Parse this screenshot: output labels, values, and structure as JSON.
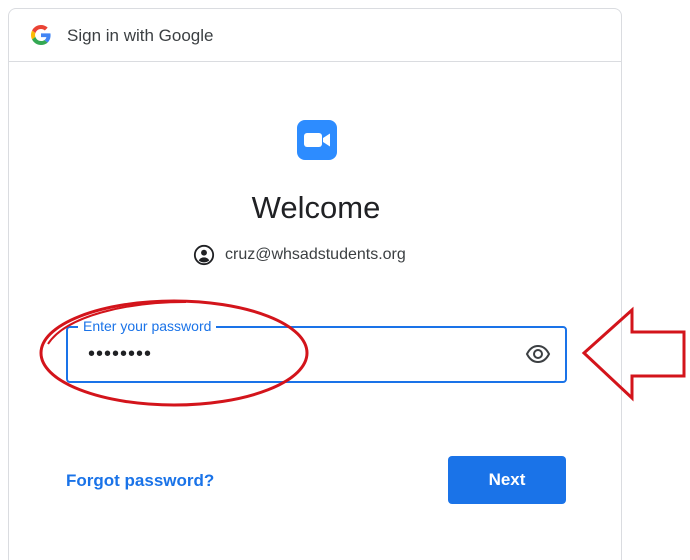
{
  "header": {
    "title": "Sign in with Google",
    "logo_icon": "google-g-icon"
  },
  "app": {
    "logo_icon": "zoom-video-icon",
    "accent": "#2d8cff"
  },
  "main": {
    "heading": "Welcome",
    "account_icon": "account-circle-icon",
    "account_email": "cruz@whsadstudents.org"
  },
  "password": {
    "label": "Enter your password",
    "value": "••••••••",
    "toggle_icon": "eye-icon"
  },
  "actions": {
    "forgot_label": "Forgot password?",
    "next_label": "Next"
  },
  "colors": {
    "primary": "#1a73e8",
    "annotation": "#d3141b",
    "border": "#dadce0"
  },
  "annotations": {
    "highlight": "red-ellipse",
    "pointer": "red-left-arrow-icon"
  }
}
